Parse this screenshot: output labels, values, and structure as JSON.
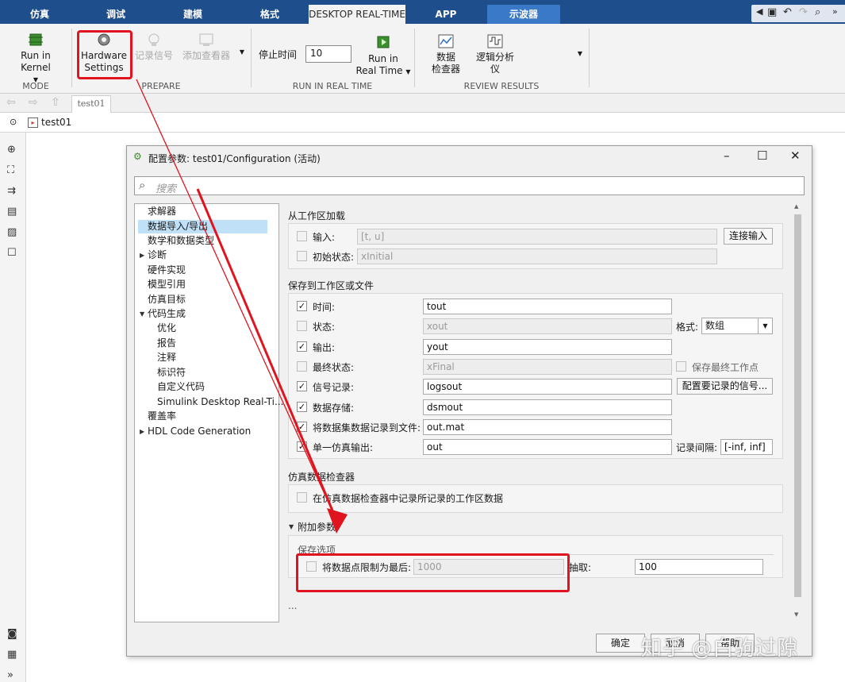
{
  "tabs": [
    "仿真",
    "调试",
    "建模",
    "格式",
    "DESKTOP REAL-TIME",
    "APP",
    "示波器"
  ],
  "active_tab": "DESKTOP REAL-TIME",
  "ribbon": {
    "run_in_kernel": "Run in Kernel",
    "hardware_settings_1": "Hardware",
    "hardware_settings_2": "Settings",
    "record_signal": "记录信号",
    "add_viewer": "添加查看器",
    "stop_time_label": "停止时间",
    "stop_time_value": "10",
    "run_rt_1": "Run in",
    "run_rt_2": "Real Time",
    "data_inspector_1": "数据",
    "data_inspector_2": "检查器",
    "logic_analyzer_1": "逻辑分析",
    "logic_analyzer_2": "仪",
    "groups": {
      "mode": "MODE",
      "prepare": "PREPARE",
      "run": "RUN IN REAL TIME",
      "review": "REVIEW RESULTS"
    }
  },
  "nav": {
    "tab": "test01",
    "breadcrumb": "test01"
  },
  "dialog": {
    "title": "配置参数: test01/Configuration (活动)",
    "search_placeholder": "搜索",
    "tree": {
      "solver": "求解器",
      "data_io": "数据导入/导出",
      "math": "数学和数据类型",
      "diagnostics": "诊断",
      "hardware": "硬件实现",
      "model_ref": "模型引用",
      "sim_target": "仿真目标",
      "codegen": "代码生成",
      "optimization": "优化",
      "report": "报告",
      "comments": "注释",
      "identifiers": "标识符",
      "custom_code": "自定义代码",
      "sldrt": "Simulink Desktop Real-Ti...",
      "coverage": "覆盖率",
      "hdl": "HDL Code Generation"
    },
    "load": {
      "title": "从工作区加载",
      "input_label": "输入:",
      "input_value": "[t, u]",
      "connect_button": "连接输入",
      "initial_label": "初始状态:",
      "initial_value": "xInitial"
    },
    "save": {
      "title": "保存到工作区或文件",
      "time_label": "时间:",
      "time_value": "tout",
      "states_label": "状态:",
      "states_value": "xout",
      "format_label": "格式:",
      "format_value": "数组",
      "output_label": "输出:",
      "output_value": "yout",
      "final_label": "最终状态:",
      "final_value": "xFinal",
      "save_op_label": "保存最终工作点",
      "siglog_label": "信号记录:",
      "siglog_value": "logsout",
      "configure_button": "配置要记录的信号...",
      "dsm_label": "数据存储:",
      "dsm_value": "dsmout",
      "tofile_label": "将数据集数据记录到文件:",
      "tofile_value": "out.mat",
      "single_label": "单一仿真输出:",
      "single_value": "out",
      "interval_label": "记录间隔:",
      "interval_value": "[-inf, inf]"
    },
    "sdi": {
      "title": "仿真数据检查器",
      "record_label": "在仿真数据检查器中记录所记录的工作区数据"
    },
    "additional": {
      "title": "附加参数",
      "save_options": "保存选项",
      "limit_label": "将数据点限制为最后:",
      "limit_value": "1000",
      "decimation_label": "抽取:",
      "decimation_value": "100",
      "ellipsis": "..."
    },
    "buttons": {
      "ok": "确定",
      "cancel": "取消",
      "help": "帮助"
    }
  },
  "watermark": "知乎 @白驹过隙",
  "colors": {
    "tabbar": "#1f4e8c",
    "accent_red": "#e0141e",
    "selection": "#bfe0f7"
  }
}
